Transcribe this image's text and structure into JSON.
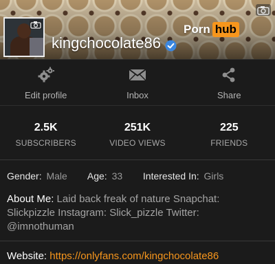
{
  "header": {
    "logo_part1": "Porn",
    "logo_part2": "hub",
    "username": "kingchocolate86",
    "accent": "#f7961c",
    "verified_color": "#3b87e0"
  },
  "actions": [
    {
      "label": "Edit profile",
      "icon": "gear-icon"
    },
    {
      "label": "Inbox",
      "icon": "envelope-icon"
    },
    {
      "label": "Share",
      "icon": "share-icon"
    }
  ],
  "stats": [
    {
      "value": "2.5K",
      "label": "SUBSCRIBERS"
    },
    {
      "value": "251K",
      "label": "VIDEO VIEWS"
    },
    {
      "value": "225",
      "label": "FRIENDS"
    }
  ],
  "info": {
    "gender_label": "Gender:",
    "gender_value": "Male",
    "age_label": "Age:",
    "age_value": "33",
    "interested_label": "Interested In:",
    "interested_value": "Girls"
  },
  "about": {
    "label": "About Me:",
    "text": "Laid back freak of nature Snapchat: Slickpizzle Instagram: Slick_pizzle Twitter: @imnothuman"
  },
  "website": {
    "label": "Website:",
    "url": "https://onlyfans.com/kingchocolate86"
  }
}
